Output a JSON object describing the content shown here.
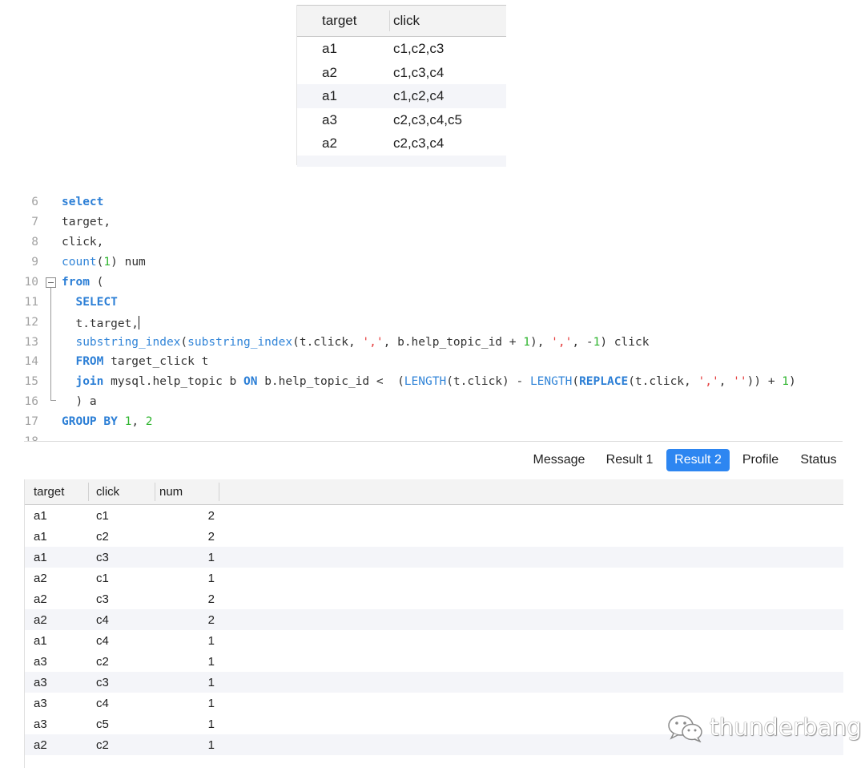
{
  "source_table": {
    "columns": [
      "target",
      "click"
    ],
    "rows": [
      [
        "a1",
        "c1,c2,c3"
      ],
      [
        "a2",
        "c1,c3,c4"
      ],
      [
        "a1",
        "c1,c2,c4"
      ],
      [
        "a3",
        "c2,c3,c4,c5"
      ],
      [
        "a2",
        "c2,c3,c4"
      ]
    ]
  },
  "editor": {
    "lines": [
      {
        "n": "6",
        "text": "select"
      },
      {
        "n": "7",
        "text": "target,"
      },
      {
        "n": "8",
        "text": "click,"
      },
      {
        "n": "9",
        "text": "count(1) num"
      },
      {
        "n": "10",
        "text": "from ("
      },
      {
        "n": "11",
        "text": "  SELECT"
      },
      {
        "n": "12",
        "text": "  t.target,"
      },
      {
        "n": "13",
        "text": "  substring_index(substring_index(t.click, ',', b.help_topic_id + 1), ',', -1) click"
      },
      {
        "n": "14",
        "text": "  FROM target_click t"
      },
      {
        "n": "15",
        "text": "  join mysql.help_topic b ON b.help_topic_id <  (LENGTH(t.click) - LENGTH(REPLACE(t.click, ',', '')) + 1)"
      },
      {
        "n": "16",
        "text": "  ) a"
      },
      {
        "n": "17",
        "text": "GROUP BY 1, 2"
      },
      {
        "n": "18",
        "text": ""
      }
    ]
  },
  "tabs": {
    "items": [
      "Message",
      "Result 1",
      "Result 2",
      "Profile",
      "Status"
    ],
    "active": "Result 2"
  },
  "result": {
    "columns": [
      "target",
      "click",
      "num"
    ],
    "rows": [
      [
        "a1",
        "c1",
        "2"
      ],
      [
        "a1",
        "c2",
        "2"
      ],
      [
        "a1",
        "c3",
        "1"
      ],
      [
        "a2",
        "c1",
        "1"
      ],
      [
        "a2",
        "c3",
        "2"
      ],
      [
        "a2",
        "c4",
        "2"
      ],
      [
        "a1",
        "c4",
        "1"
      ],
      [
        "a3",
        "c2",
        "1"
      ],
      [
        "a3",
        "c3",
        "1"
      ],
      [
        "a3",
        "c4",
        "1"
      ],
      [
        "a3",
        "c5",
        "1"
      ],
      [
        "a2",
        "c2",
        "1"
      ]
    ]
  },
  "watermark": {
    "text": "thunderbang",
    "icon": "wechat-icon"
  },
  "colors": {
    "keyword": "#2c7fd6",
    "number": "#2fb52f",
    "string": "#e53c3c",
    "active_tab": "#2d86f1",
    "row_stripe": "#f4f5f9"
  }
}
